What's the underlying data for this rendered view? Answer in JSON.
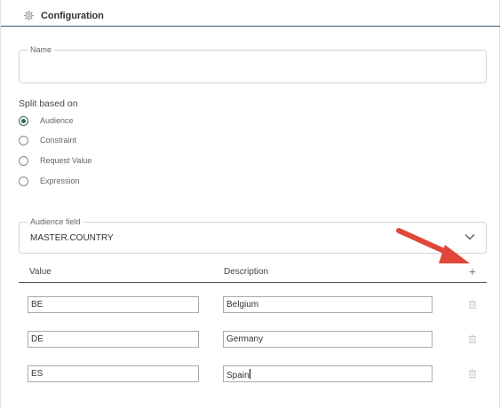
{
  "header": {
    "title": "Configuration",
    "icon": "gear-icon"
  },
  "name_field": {
    "label": "Name",
    "value": ""
  },
  "split": {
    "label": "Split based on",
    "selected": "Audience",
    "options": [
      "Audience",
      "Constraint",
      "Request Value",
      "Expression"
    ]
  },
  "audience_field": {
    "label": "Audience field",
    "value": "MASTER.COUNTRY"
  },
  "table": {
    "headers": {
      "value": "Value",
      "description": "Description",
      "add": "+"
    },
    "rows": [
      {
        "value": "BE",
        "description": "Belgium"
      },
      {
        "value": "DE",
        "description": "Germany"
      },
      {
        "value": "ES",
        "description": "Spain"
      }
    ]
  },
  "colors": {
    "accent": "#2f6b5c",
    "header_rule": "#2e5c6e",
    "arrow": "#e0463a"
  }
}
